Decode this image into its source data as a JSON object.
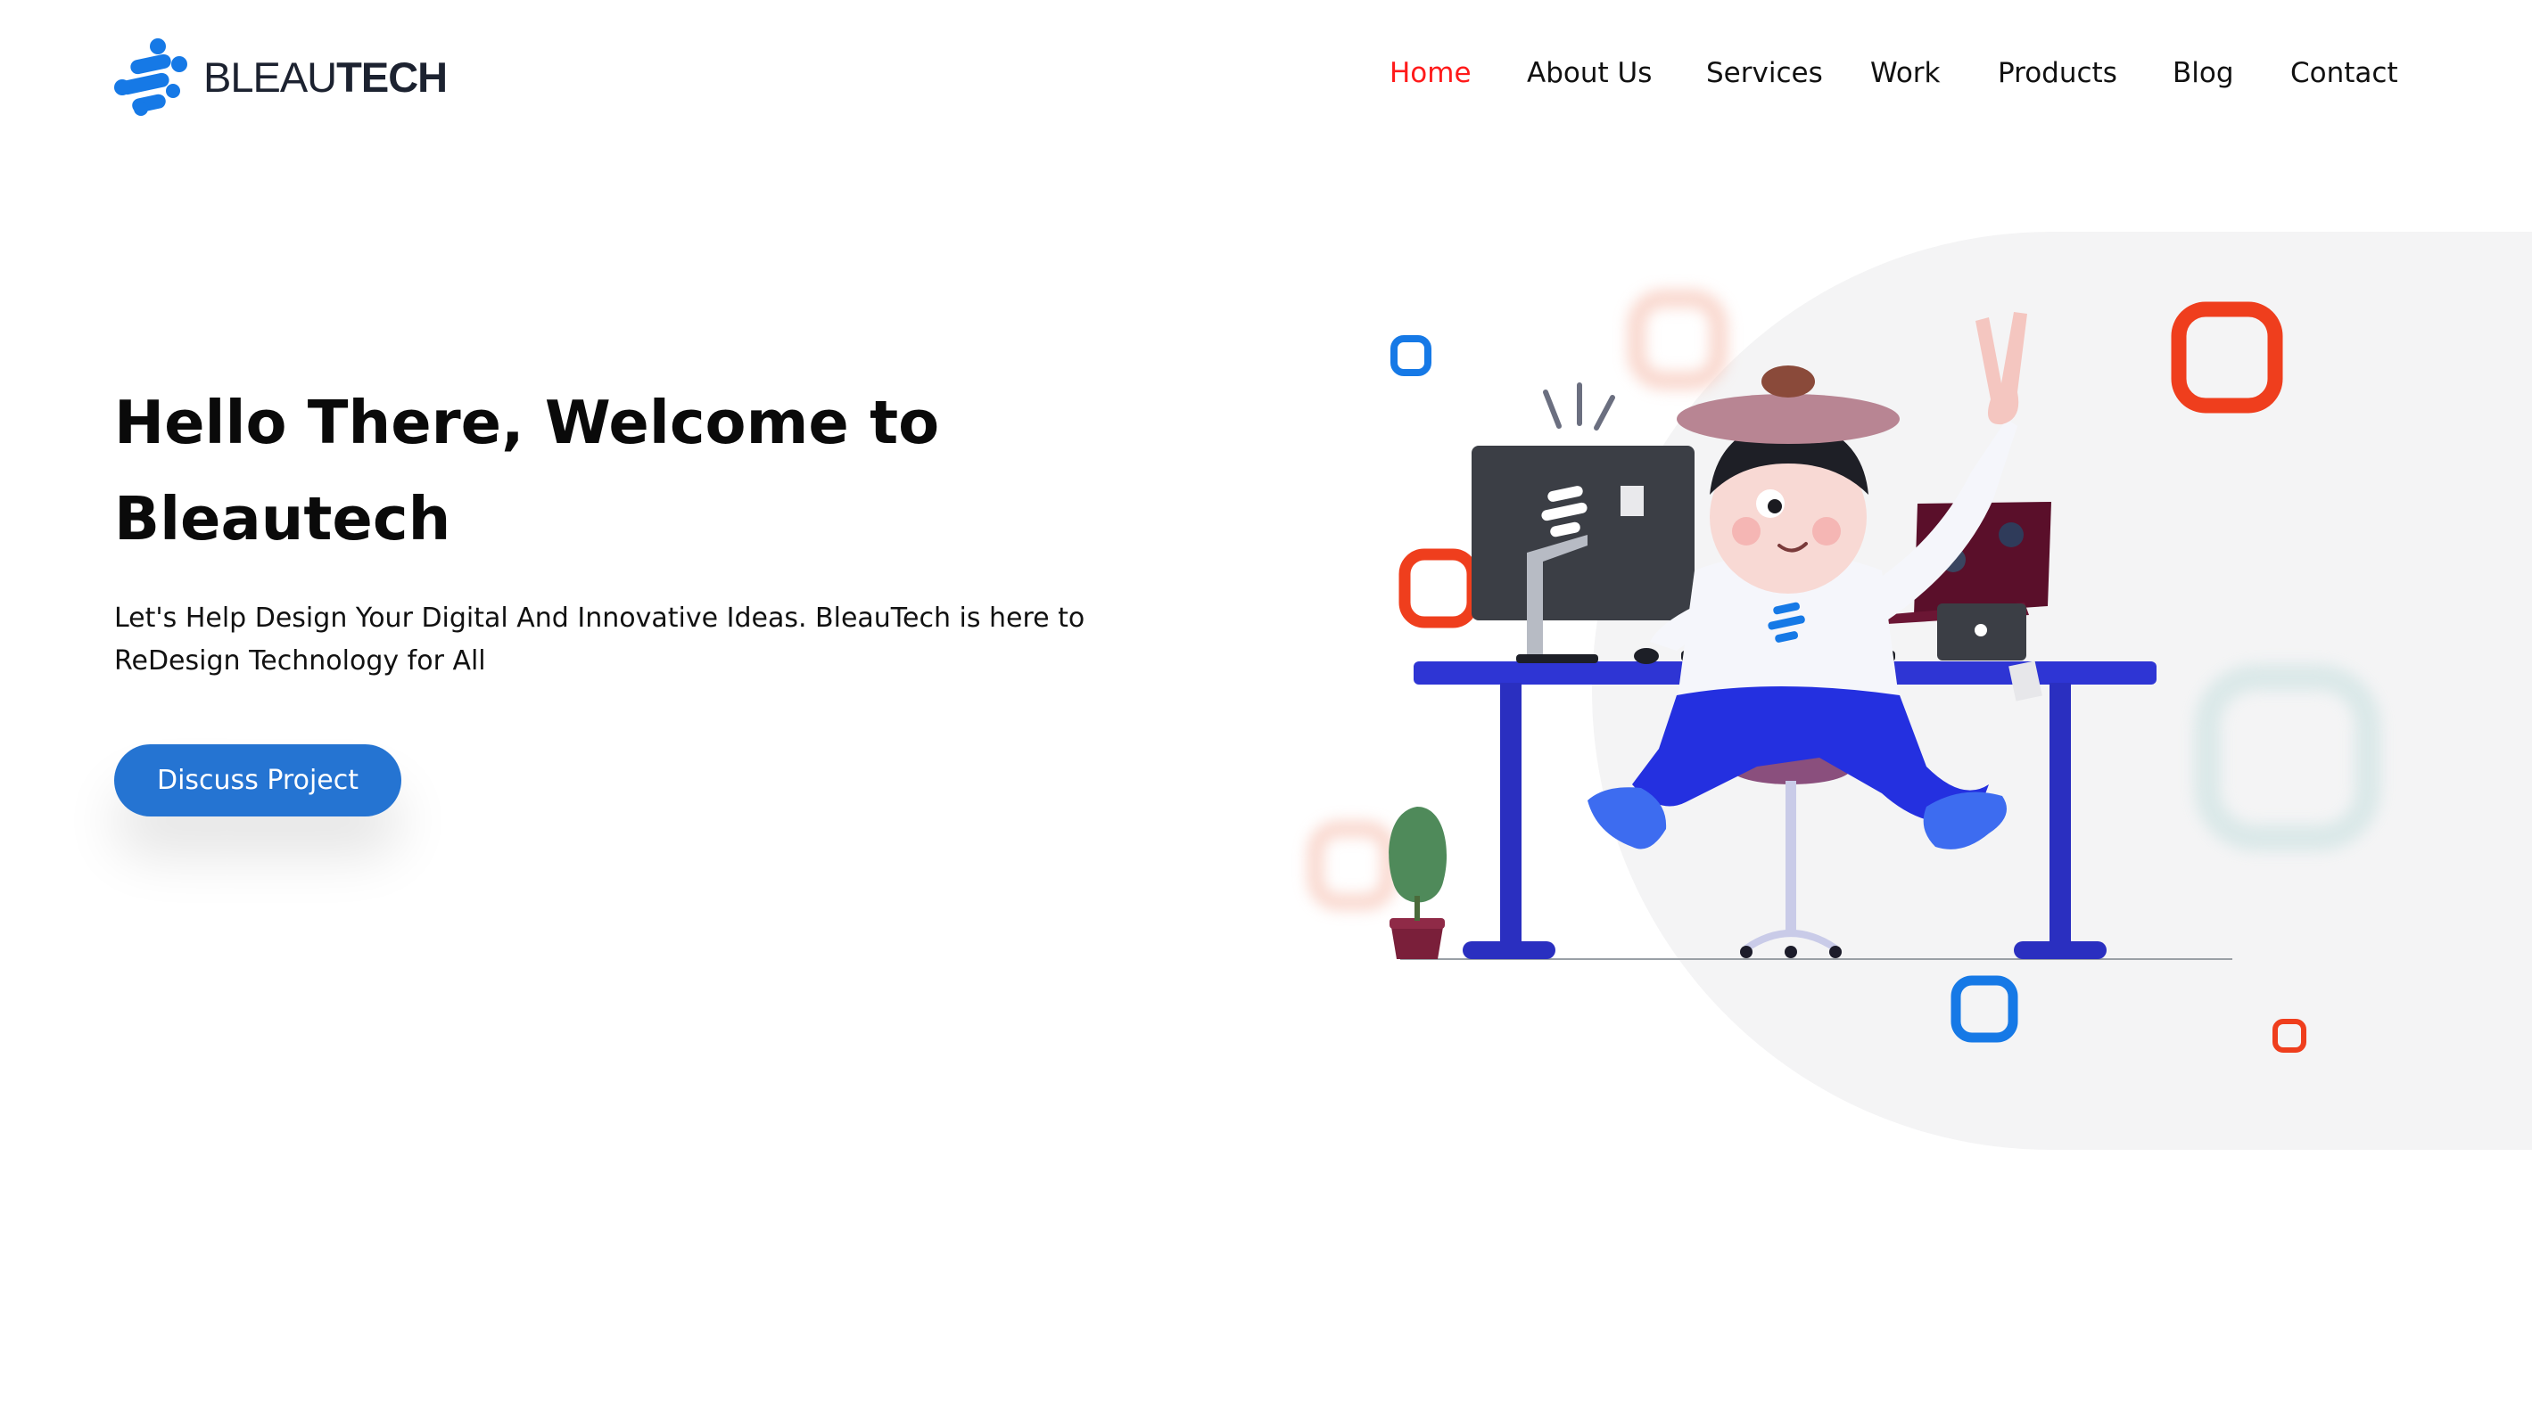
{
  "brand": {
    "logo_light": "BLEAU",
    "logo_bold": "TECH",
    "logo_icon": "molecule-logo-icon",
    "accent": "#2574d2"
  },
  "nav": {
    "active_color": "#ff1a1a",
    "items": [
      {
        "label": "Home",
        "active": true
      },
      {
        "label": "About Us",
        "active": false
      },
      {
        "label": "Services",
        "active": false
      },
      {
        "label": "Work",
        "active": false
      },
      {
        "label": "Products",
        "active": false
      },
      {
        "label": "Blog",
        "active": false
      },
      {
        "label": "Contact",
        "active": false
      }
    ]
  },
  "hero": {
    "title_line1": "Hello There, Welcome to",
    "title_line2": "Bleautech",
    "subtitle_line1": "Let's Help Design Your Digital And Innovative Ideas. BleauTech is here to",
    "subtitle_line2": "ReDesign Technology for All",
    "cta_label": "Discuss Project"
  },
  "illustration": {
    "subject": "3d-character-at-desk-illustration",
    "colors": {
      "desk": "#2e35d4",
      "orange_square": "#ef3e1d",
      "blue_square": "#1679e6"
    }
  }
}
